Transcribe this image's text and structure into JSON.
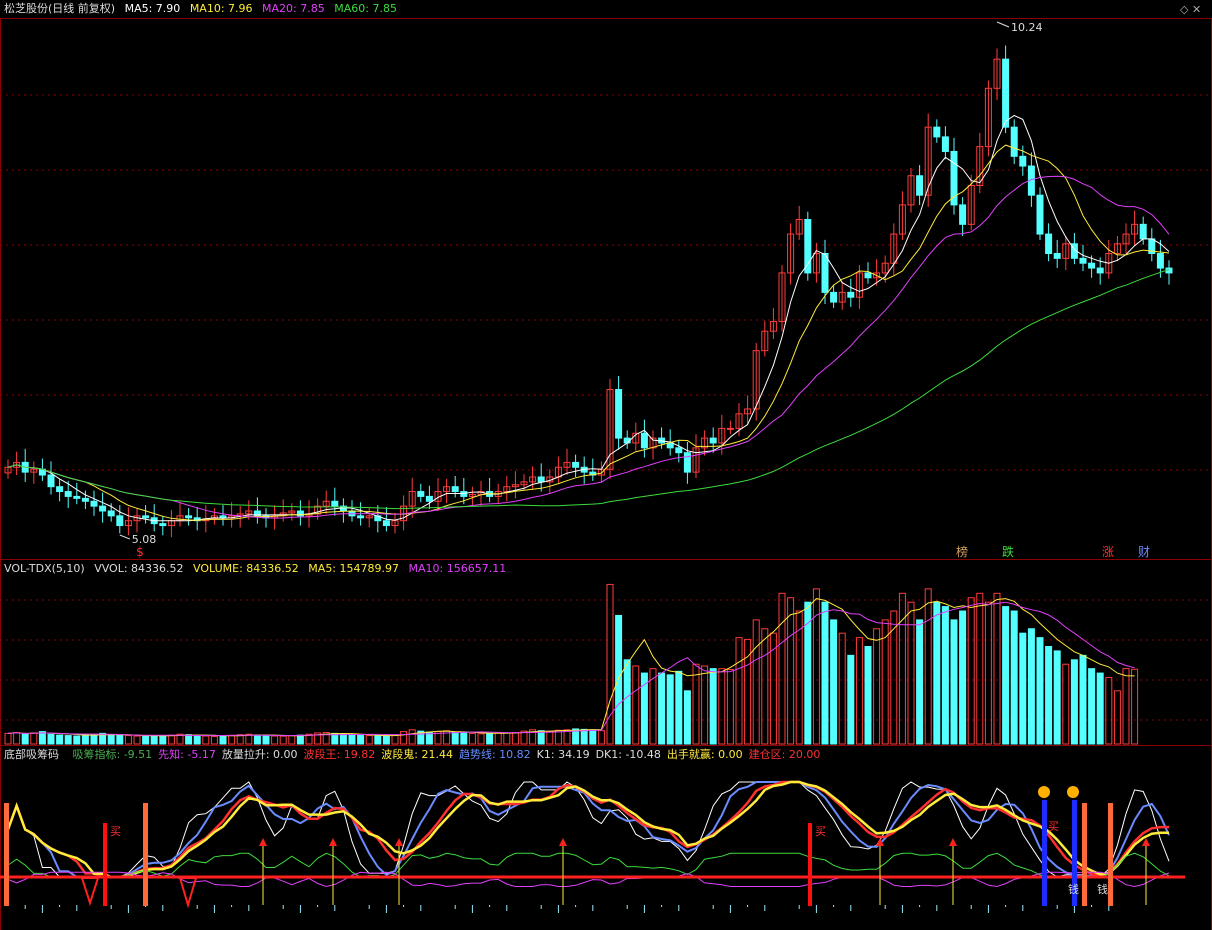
{
  "main": {
    "title": "松芝股份(日线 前复权)",
    "ma5": "MA5: 7.90",
    "ma10": "MA10: 7.96",
    "ma20": "MA20: 7.85",
    "ma60": "MA60: 7.85",
    "high_label": "10.24",
    "low_label": "5.08",
    "markers": [
      "$",
      "榜",
      "跌",
      "涨",
      "财"
    ]
  },
  "volume": {
    "title": "VOL-TDX(5,10)",
    "vvol": "VVOL: 84336.52",
    "volume": "VOLUME: 84336.52",
    "ma5": "MA5: 154789.97",
    "ma10": "MA10: 156657.11"
  },
  "indicator": {
    "title": "底部吸筹码",
    "items": [
      {
        "text": "吸筹指标: -9.51",
        "color": "#4caf50"
      },
      {
        "text": "先知: -5.17",
        "color": "#e040fb"
      },
      {
        "text": "放量拉升: 0.00",
        "color": "#dddddd"
      },
      {
        "text": "波段王: 19.82",
        "color": "#ff3030"
      },
      {
        "text": "波段鬼: 21.44",
        "color": "#ffeb3b"
      },
      {
        "text": "趋势线: 10.82",
        "color": "#6a8cff"
      },
      {
        "text": "K1: 34.19",
        "color": "#dddddd"
      },
      {
        "text": "DK1: -10.48",
        "color": "#dddddd"
      },
      {
        "text": "出手就赢: 0.00",
        "color": "#ffeb3b"
      },
      {
        "text": "建仓区: 20.00",
        "color": "#ff3030"
      }
    ],
    "signal_labels": [
      "买",
      "买",
      "买",
      "钱",
      "钱"
    ]
  },
  "chart_data": [
    {
      "type": "candlestick",
      "title": "松芝股份(日线 前复权)",
      "y_high": 10.24,
      "y_low": 5.08,
      "close": [
        5.8,
        5.85,
        5.75,
        5.78,
        5.72,
        5.6,
        5.55,
        5.5,
        5.48,
        5.45,
        5.4,
        5.35,
        5.3,
        5.2,
        5.25,
        5.3,
        5.28,
        5.22,
        5.2,
        5.25,
        5.3,
        5.28,
        5.25,
        5.27,
        5.3,
        5.28,
        5.3,
        5.32,
        5.35,
        5.3,
        5.28,
        5.3,
        5.33,
        5.35,
        5.3,
        5.32,
        5.4,
        5.45,
        5.4,
        5.35,
        5.3,
        5.28,
        5.3,
        5.25,
        5.2,
        5.25,
        5.4,
        5.55,
        5.5,
        5.45,
        5.55,
        5.6,
        5.55,
        5.5,
        5.52,
        5.55,
        5.5,
        5.55,
        5.6,
        5.62,
        5.65,
        5.7,
        5.65,
        5.7,
        5.8,
        5.85,
        5.8,
        5.75,
        5.72,
        5.78,
        6.6,
        6.1,
        6.05,
        6.15,
        6.0,
        6.1,
        6.05,
        6.0,
        5.95,
        5.75,
        6.0,
        6.1,
        6.05,
        6.2,
        6.2,
        6.35,
        6.4,
        7.0,
        7.2,
        7.3,
        7.8,
        8.2,
        8.35,
        7.8,
        8.0,
        7.6,
        7.5,
        7.6,
        7.55,
        7.8,
        7.75,
        7.8,
        7.9,
        8.2,
        8.5,
        8.8,
        8.6,
        9.3,
        9.2,
        9.05,
        8.5,
        8.3,
        8.7,
        9.1,
        9.7,
        10.0,
        9.3,
        9.0,
        8.9,
        8.6,
        8.2,
        8.0,
        7.95,
        8.1,
        7.95,
        7.9,
        7.85,
        7.8,
        8.0,
        8.1,
        8.2,
        8.3,
        8.15,
        8.0,
        7.85,
        7.8
      ]
    },
    {
      "type": "bar",
      "title": "VOL-TDX(5,10)",
      "values": [
        12000,
        13000,
        11000,
        12500,
        14000,
        11000,
        10000,
        9500,
        9000,
        10500,
        11000,
        12000,
        10000,
        9800,
        9500,
        9000,
        8800,
        9200,
        9500,
        10000,
        11000,
        10500,
        9800,
        9000,
        8500,
        9200,
        9800,
        10500,
        11000,
        10000,
        9500,
        9000,
        8800,
        9500,
        10000,
        11000,
        12500,
        13000,
        12000,
        11000,
        10000,
        9800,
        9500,
        9000,
        9300,
        9800,
        14000,
        16000,
        14500,
        13500,
        14000,
        15000,
        13000,
        12500,
        12000,
        11500,
        12000,
        13000,
        12500,
        13000,
        14500,
        16000,
        15000,
        14000,
        15500,
        16000,
        17000,
        16500,
        16000,
        15000,
        180000,
        145000,
        95000,
        88000,
        80000,
        85000,
        80000,
        78000,
        82000,
        60000,
        90000,
        88000,
        85000,
        85000,
        84000,
        120000,
        118000,
        140000,
        130000,
        125000,
        170000,
        165000,
        150000,
        160000,
        175000,
        160000,
        140000,
        125000,
        100000,
        120000,
        110000,
        130000,
        140000,
        150000,
        170000,
        160000,
        140000,
        175000,
        160000,
        155000,
        140000,
        150000,
        165000,
        170000,
        160000,
        170000,
        155000,
        150000,
        125000,
        130000,
        120000,
        110000,
        105000,
        90000,
        95000,
        100000,
        85000,
        80000,
        75000,
        60000,
        85000,
        84336.52
      ]
    },
    {
      "type": "line",
      "title": "底部吸筹码",
      "series": [
        {
          "name": "吸筹指标",
          "last": -9.51
        },
        {
          "name": "先知",
          "last": -5.17
        },
        {
          "name": "放量拉升",
          "last": 0.0
        },
        {
          "name": "波段王",
          "last": 19.82
        },
        {
          "name": "波段鬼",
          "last": 21.44
        },
        {
          "name": "趋势线",
          "last": 10.82
        },
        {
          "name": "K1",
          "last": 34.19
        },
        {
          "name": "DK1",
          "last": -10.48
        },
        {
          "name": "出手就赢",
          "last": 0.0
        },
        {
          "name": "建仓区",
          "last": 20.0
        }
      ]
    }
  ]
}
